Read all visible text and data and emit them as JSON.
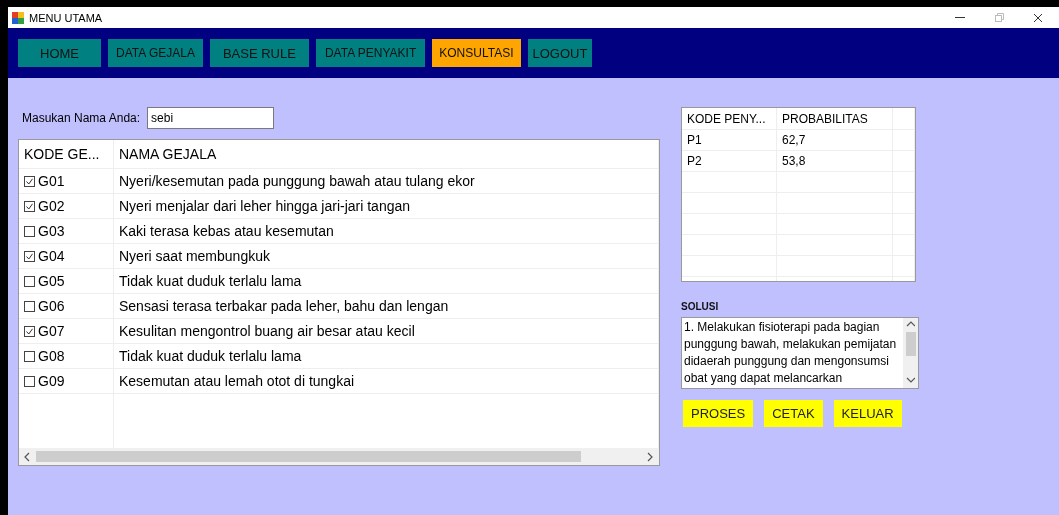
{
  "window": {
    "title": "MENU UTAMA"
  },
  "menu": [
    {
      "label": "HOME",
      "selected": false
    },
    {
      "label": "DATA GEJALA",
      "selected": false
    },
    {
      "label": "BASE RULE",
      "selected": false
    },
    {
      "label": "DATA PENYAKIT",
      "selected": false
    },
    {
      "label": "KONSULTASI",
      "selected": true
    },
    {
      "label": "LOGOUT",
      "selected": false
    }
  ],
  "name_field": {
    "label": "Masukan Nama Anda:",
    "value": "sebi"
  },
  "symptoms_table": {
    "columns": [
      "KODE GE...",
      "NAMA GEJALA"
    ],
    "rows": [
      {
        "code": "G01",
        "name": "Nyeri/kesemutan pada punggung bawah atau tulang ekor",
        "checked": true
      },
      {
        "code": "G02",
        "name": "Nyeri menjalar dari leher hingga jari-jari tangan",
        "checked": true
      },
      {
        "code": "G03",
        "name": "Kaki terasa kebas atau kesemutan",
        "checked": false
      },
      {
        "code": "G04",
        "name": "Nyeri saat membungkuk",
        "checked": true
      },
      {
        "code": "G05",
        "name": "Tidak kuat duduk terlalu lama",
        "checked": false
      },
      {
        "code": "G06",
        "name": "Sensasi terasa terbakar pada leher, bahu dan lengan",
        "checked": false
      },
      {
        "code": "G07",
        "name": "Kesulitan mengontrol buang air besar atau kecil",
        "checked": true
      },
      {
        "code": "G08",
        "name": "Tidak kuat duduk terlalu lama",
        "checked": false
      },
      {
        "code": "G09",
        "name": "Kesemutan atau lemah otot di tungkai",
        "checked": false
      }
    ]
  },
  "result_table": {
    "columns": [
      "KODE PENY...",
      "PROBABILITAS"
    ],
    "rows": [
      {
        "code": "P1",
        "probability": "62,7"
      },
      {
        "code": "P2",
        "probability": "53,8"
      }
    ]
  },
  "solution": {
    "label": "SOLUSI",
    "text": "1. Melakukan fisioterapi pada bagian punggung bawah, melakukan pemijatan didaerah punggung dan mengonsumsi obat yang dapat melancarkan"
  },
  "buttons": [
    "PROSES",
    "CETAK",
    "KELUAR"
  ]
}
